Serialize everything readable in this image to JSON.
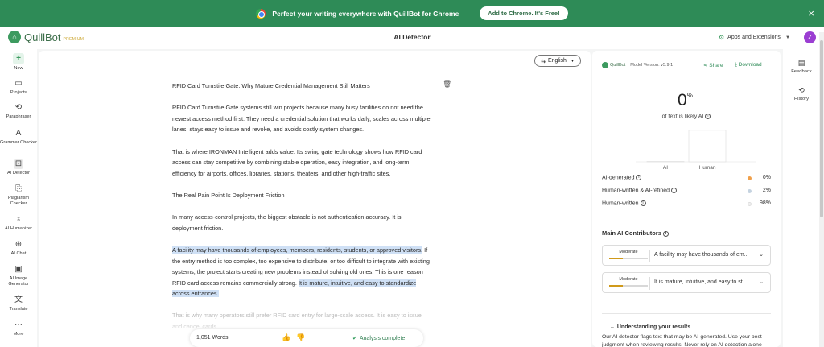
{
  "banner": {
    "message": "Perfect your writing everywhere with QuillBot for Chrome",
    "cta": "Add to Chrome. It's Free!",
    "close_icon": "×"
  },
  "header": {
    "logo_name": "QuillBot",
    "logo_tier": "PREMIUM",
    "title": "AI Detector",
    "apps_label": "Apps and Extensions",
    "avatar_initial": "Z"
  },
  "sidebar": {
    "items": [
      {
        "label": "New",
        "icon": "+"
      },
      {
        "label": "Projects",
        "icon": "▭"
      },
      {
        "label": "Paraphraser",
        "icon": "⟲"
      },
      {
        "label": "Grammar Checker",
        "icon": "A"
      },
      {
        "label": "AI Detector",
        "icon": "⊡"
      },
      {
        "label": "Plagiarism Checker",
        "icon": "⎘"
      },
      {
        "label": "AI Humanizer",
        "icon": "♁"
      },
      {
        "label": "AI Chat",
        "icon": "⊕"
      },
      {
        "label": "AI Image Generator",
        "icon": "▣"
      },
      {
        "label": "Translate",
        "icon": "文"
      },
      {
        "label": "More",
        "icon": "···"
      }
    ]
  },
  "editor": {
    "language": "English",
    "paragraphs": {
      "p1": "RFID Card Turnstile Gate: Why Mature Credential Management Still Matters",
      "p2": "RFID Card Turnstile Gate systems still win projects because many busy facilities do not need the newest access method first. They need a credential solution that works daily, scales across multiple lanes, stays easy to issue and revoke, and avoids costly system changes.",
      "p3": "That is where IRONMAN Intelligent adds value. Its swing gate technology shows how RFID card access can stay competitive by combining stable operation, easy integration, and long-term efficiency for airports, offices, libraries, stations, theaters, and other high-traffic sites.",
      "p4": "The Real Pain Point Is Deployment Friction",
      "p5": "In many access-control projects, the biggest obstacle is not authentication accuracy. It is deployment friction.",
      "p6_hl1": "A facility may have thousands of employees, members, residents, students, or approved visitors.",
      "p6_mid": " If the entry method is too complex, too expensive to distribute, or too difficult to integrate with existing systems, the project starts creating new problems instead of solving old ones. This is one reason RFID card access remains commercially strong. ",
      "p6_hl2": "It is mature, intuitive, and easy to standardize across entrances.",
      "p7": "That is why many operators still prefer RFID card entry for large-scale access. It is easy to issue and cancel cards"
    },
    "word_count": "1,051 Words",
    "status": "Analysis complete"
  },
  "panel": {
    "brand": "QuillBot",
    "model_version": "Model Version: v5.9.1",
    "share": "Share",
    "download": "Download",
    "score": "0",
    "score_unit": "%",
    "score_caption": "of text is likely AI",
    "bars": [
      {
        "label": "AI",
        "value": 0
      },
      {
        "label": "Human",
        "value": 98
      }
    ],
    "legend": [
      {
        "label": "AI-generated",
        "value": "0%",
        "color": "#f0a04b"
      },
      {
        "label": "Human-written & AI-refined",
        "value": "2%",
        "color": "#c5d3e0"
      },
      {
        "label": "Human-written",
        "value": "98%",
        "color": "#f2f2f2"
      }
    ],
    "contributors_title": "Main AI Contributors",
    "contributors": [
      {
        "level": "Moderate",
        "text": "A facility may have thousands of em...",
        "fill": 0.35
      },
      {
        "level": "Moderate",
        "text": "It is mature, intuitive, and easy to st...",
        "fill": 0.35
      }
    ],
    "understanding_title": "Understanding your results",
    "understanding_body": "Our AI detector flags text that may be AI-generated. Use your best judgment when reviewing results. Never rely on AI detection alone"
  },
  "rail": {
    "feedback": "Feedback",
    "history": "History"
  }
}
